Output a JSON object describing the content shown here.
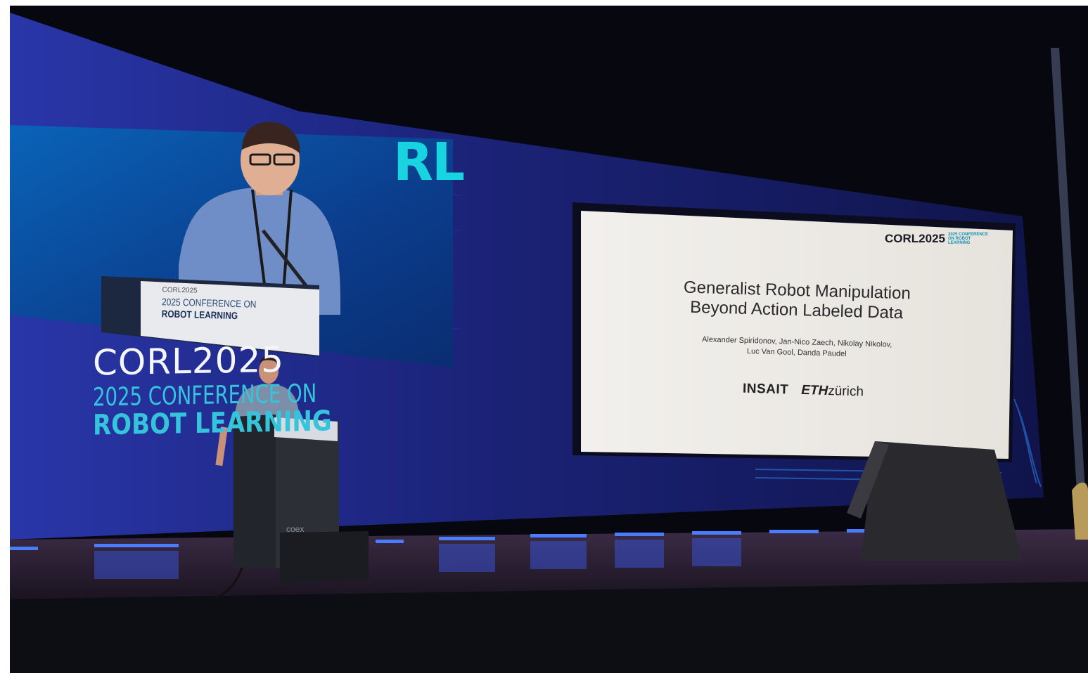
{
  "scene": {
    "description_free": true,
    "accent_cyan": "#36c4dc",
    "led_blue": "#2a3cc8",
    "stage_wood": "#6b4a36"
  },
  "wall_brand": {
    "logo_text": "CORL2025",
    "line1": "2025 CONFERENCE ON",
    "line2": "ROBOT LEARNING"
  },
  "slide": {
    "brand_logo": "CORL2025",
    "brand_sub": "2025 CONFERENCE ON ROBOT LEARNING",
    "title_line1": "Generalist Robot Manipulation",
    "title_line2": "Beyond Action Labeled Data",
    "authors_line1": "Alexander Spiridonov, Jan-Nico Zaech, Nikolay Nikolov,",
    "authors_line2": "Luc Van Gool, Danda Paudel",
    "logo_insait": "INSAIT",
    "logo_eth_bold": "ETH",
    "logo_eth_light": "zürich"
  },
  "screen_left": {
    "corner_letters": "RL",
    "podium_sign_small": "CORL2025",
    "podium_sign_line1": "2025 CONFERENCE ON",
    "podium_sign_line2": "ROBOT LEARNING"
  },
  "podium": {
    "venue_mark": "coex"
  }
}
